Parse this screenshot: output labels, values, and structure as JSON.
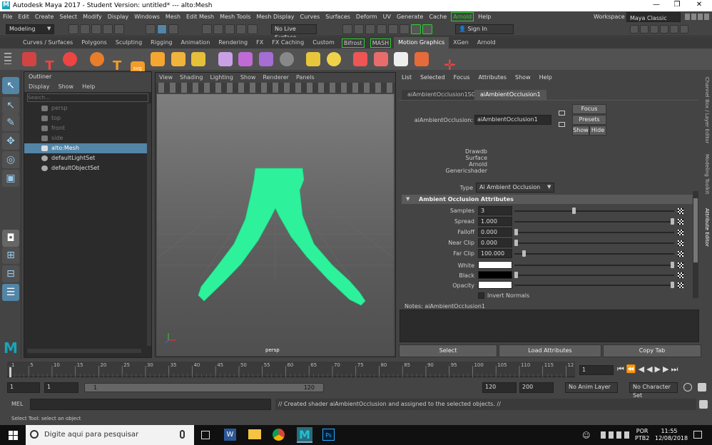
{
  "window": {
    "title": "Autodesk Maya 2017 - Student Version: untitled*   ---   alto:Mesh",
    "minimize": "—",
    "maximize": "❐",
    "close": "✕"
  },
  "menubar": {
    "items": [
      "File",
      "Edit",
      "Create",
      "Select",
      "Modify",
      "Display",
      "Windows",
      "Mesh",
      "Edit Mesh",
      "Mesh Tools",
      "Mesh Display",
      "Curves",
      "Surfaces",
      "Deform",
      "UV",
      "Generate",
      "Cache"
    ],
    "arnold": "Arnold",
    "help": "Help",
    "workspace_label": "Workspace :",
    "workspace_value": "Maya Classic"
  },
  "statusline": {
    "menuset": "Modeling",
    "live_surface": "No Live Surface",
    "sign_in": "Sign In"
  },
  "shelf_tabs": [
    "Curves / Surfaces",
    "Polygons",
    "Sculpting",
    "Rigging",
    "Animation",
    "Rendering",
    "FX",
    "FX Caching",
    "Custom",
    "Bifrost",
    "MASH",
    "Motion Graphics",
    "XGen",
    "Arnold"
  ],
  "shelf_active": "Motion Graphics",
  "outliner": {
    "title": "Outliner",
    "menu": [
      "Display",
      "Show",
      "Help"
    ],
    "search_placeholder": "Search...",
    "items": [
      "persp",
      "top",
      "front",
      "side",
      "alto:Mesh",
      "defaultLightSet",
      "defaultObjectSet"
    ]
  },
  "viewport": {
    "menu": [
      "View",
      "Shading",
      "Lighting",
      "Show",
      "Renderer",
      "Panels"
    ],
    "camera_label": "persp"
  },
  "attr_editor": {
    "menu": [
      "List",
      "Selected",
      "Focus",
      "Attributes",
      "Show",
      "Help"
    ],
    "tabs": [
      "aiAmbientOcclusion1SG",
      "aiAmbientOcclusion1"
    ],
    "node_label": "aiAmbientOcclusion:",
    "node_value": "aiAmbientOcclusion1",
    "buttons": {
      "focus": "Focus",
      "presets": "Presets",
      "show": "Show",
      "hide": "Hide"
    },
    "classification": [
      "Drawdb",
      "Surface",
      "Arnold",
      "Genericshader"
    ],
    "type_label": "Type",
    "type_value": "Ai Ambient Occlusion",
    "section_title": "Ambient Occlusion Attributes",
    "attrs": [
      {
        "label": "Samples",
        "value": "3",
        "pos": 0.37
      },
      {
        "label": "Spread",
        "value": "1.000",
        "pos": 1.0
      },
      {
        "label": "Falloff",
        "value": "0.000",
        "pos": 0.0
      },
      {
        "label": "Near Clip",
        "value": "0.000",
        "pos": 0.0
      },
      {
        "label": "Far Clip",
        "value": "100.000",
        "pos": 0.05
      }
    ],
    "colors": [
      {
        "label": "White",
        "color": "#ffffff"
      },
      {
        "label": "Black",
        "color": "#000000"
      },
      {
        "label": "Opacity",
        "color": "#ffffff"
      }
    ],
    "invert_label": "Invert Normals",
    "notes_label": "Notes:  aiAmbientOcclusion1",
    "bottom_buttons": [
      "Select",
      "Load Attributes",
      "Copy Tab"
    ]
  },
  "side_tabs": [
    "Channel Box / Layer Editor",
    "Modeling Toolkit",
    "Attribute Editor"
  ],
  "timeline": {
    "ticks": [
      "1",
      "5",
      "10",
      "15",
      "20",
      "25",
      "30",
      "35",
      "40",
      "45",
      "50",
      "55",
      "60",
      "65",
      "70",
      "75",
      "80",
      "85",
      "90",
      "95",
      "100",
      "105",
      "110",
      "115",
      "12"
    ],
    "current_frame": "1"
  },
  "range": {
    "start": "1",
    "start2": "1",
    "slider_start": "1",
    "slider_end": "120",
    "end": "120",
    "end2": "200",
    "anim_layer": "No Anim Layer",
    "char_set": "No Character Set"
  },
  "command": {
    "lang": "MEL",
    "result": "// Created shader aiAmbientOcclusion and assigned to the selected objects. //"
  },
  "helpline": "Select Tool: select an object",
  "taskbar": {
    "search_placeholder": "Digite aqui para pesquisar",
    "lang1": "POR",
    "lang2": "PTB2",
    "time": "11:55",
    "date": "12/08/2018"
  },
  "colors": {
    "mesh": "#2ef29b",
    "selection": "#5285a6",
    "accent_green": "#33cc33"
  }
}
